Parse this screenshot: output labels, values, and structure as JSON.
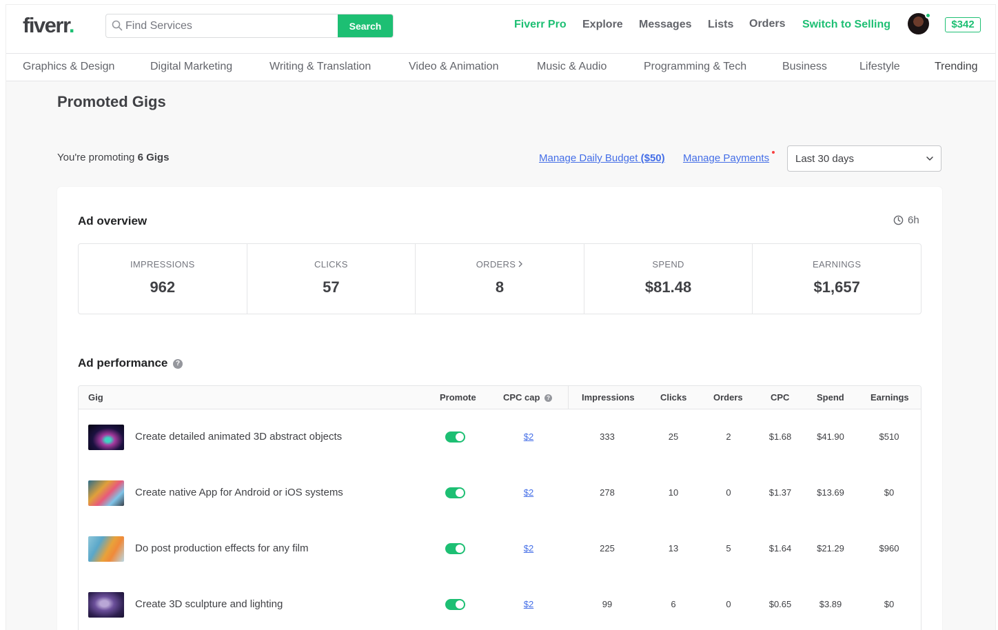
{
  "header": {
    "logo_text": "fiverr",
    "logo_dot": ".",
    "search_placeholder": "Find Services",
    "search_button": "Search",
    "nav": {
      "fiverr_pro": "Fiverr Pro",
      "explore": "Explore",
      "messages": "Messages",
      "lists": "Lists",
      "orders": "Orders",
      "switch_selling": "Switch to Selling"
    },
    "balance": "$342",
    "brand_color": "#1dbf73"
  },
  "categories": [
    "Graphics & Design",
    "Digital Marketing",
    "Writing & Translation",
    "Video & Animation",
    "Music & Audio",
    "Programming & Tech",
    "Business",
    "Lifestyle",
    "Trending"
  ],
  "page": {
    "title": "Promoted Gigs",
    "promoting_prefix": "You're promoting",
    "promoting_count": "6 Gigs",
    "manage_budget_label": "Manage Daily Budget",
    "manage_budget_amount": "($50)",
    "manage_payments": "Manage Payments",
    "date_range": "Last 30 days"
  },
  "overview": {
    "title": "Ad overview",
    "refresh": "6h",
    "stats": [
      {
        "label": "IMPRESSIONS",
        "value": "962"
      },
      {
        "label": "CLICKS",
        "value": "57"
      },
      {
        "label": "ORDERS",
        "value": "8"
      },
      {
        "label": "SPEND",
        "value": "$81.48"
      },
      {
        "label": "EARNINGS",
        "value": "$1,657"
      }
    ]
  },
  "performance": {
    "title": "Ad performance",
    "help": "?",
    "columns": {
      "gig": "Gig",
      "promote": "Promote",
      "cpc_cap": "CPC cap",
      "impressions": "Impressions",
      "clicks": "Clicks",
      "orders": "Orders",
      "cpc": "CPC",
      "spend": "Spend",
      "earnings": "Earnings"
    },
    "rows": [
      {
        "title": "Create detailed animated 3D abstract objects",
        "promote": true,
        "cpc_cap": "$2",
        "impressions": "333",
        "clicks": "25",
        "orders": "2",
        "cpc": "$1.68",
        "spend": "$41.90",
        "earnings": "$510"
      },
      {
        "title": "Create native App for Android or iOS systems",
        "promote": true,
        "cpc_cap": "$2",
        "impressions": "278",
        "clicks": "10",
        "orders": "0",
        "cpc": "$1.37",
        "spend": "$13.69",
        "earnings": "$0"
      },
      {
        "title": "Do post production effects for any film",
        "promote": true,
        "cpc_cap": "$2",
        "impressions": "225",
        "clicks": "13",
        "orders": "5",
        "cpc": "$1.64",
        "spend": "$21.29",
        "earnings": "$960"
      },
      {
        "title": "Create 3D sculpture and lighting",
        "promote": true,
        "cpc_cap": "$2",
        "impressions": "99",
        "clicks": "6",
        "orders": "0",
        "cpc": "$0.65",
        "spend": "$3.89",
        "earnings": "$0"
      }
    ]
  }
}
